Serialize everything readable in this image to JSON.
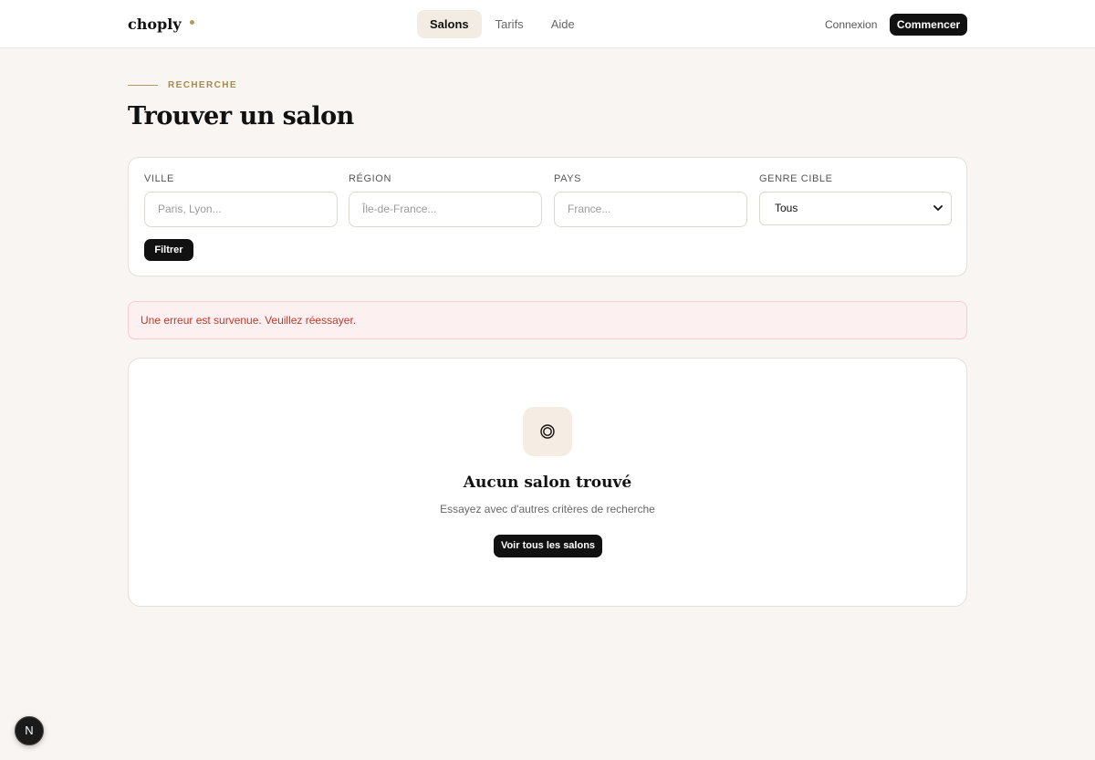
{
  "header": {
    "brand": "choply",
    "nav": [
      "Salons",
      "Tarifs",
      "Aide"
    ],
    "login_label": "Connexion",
    "cta_label": "Commencer"
  },
  "hero": {
    "eyebrow": "RECHERCHE",
    "title": "Trouver un salon"
  },
  "filters": {
    "city": {
      "label": "VILLE",
      "placeholder": "Paris, Lyon..."
    },
    "region": {
      "label": "RÉGION",
      "placeholder": "Île-de-France..."
    },
    "country": {
      "label": "PAYS",
      "placeholder": "France..."
    },
    "gender": {
      "label": "GENRE CIBLE",
      "selected": "Tous"
    },
    "submit_label": "Filtrer"
  },
  "error": {
    "message": "Une erreur est survenue. Veuillez réessayer."
  },
  "empty_state": {
    "icon": "target-icon",
    "title": "Aucun salon trouvé",
    "subtitle": "Essayez avec d'autres critères de recherche",
    "button_label": "Voir tous les salons"
  },
  "dev_badge": {
    "label": "N"
  },
  "colors": {
    "page_bg": "#f8f5f2",
    "accent_gold": "#b59a5a",
    "primary_button": "#111111",
    "error_text": "#c0392b",
    "error_bg": "#fdf0f0"
  }
}
